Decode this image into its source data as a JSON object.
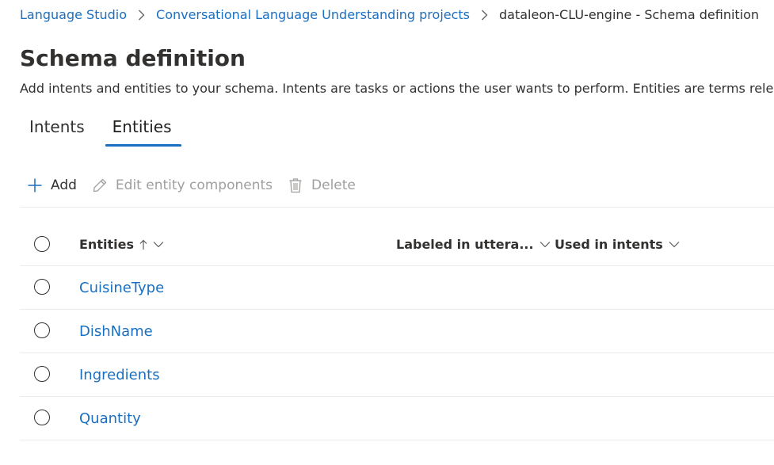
{
  "breadcrumb": {
    "items": [
      "Language Studio",
      "Conversational Language Understanding projects"
    ],
    "current": "dataleon-CLU-engine - Schema definition"
  },
  "page": {
    "title": "Schema definition",
    "description": "Add intents and entities to your schema. Intents are tasks or actions the user wants to perform. Entities are terms relevant to"
  },
  "tabs": [
    {
      "label": "Intents",
      "active": false
    },
    {
      "label": "Entities",
      "active": true
    }
  ],
  "toolbar": {
    "add_label": "Add",
    "edit_label": "Edit entity components",
    "delete_label": "Delete"
  },
  "table": {
    "columns": {
      "name": "Entities",
      "labeled": "Labeled in uttera...",
      "intents": "Used in intents"
    },
    "rows": [
      {
        "name": "CuisineType"
      },
      {
        "name": "DishName"
      },
      {
        "name": "Ingredients"
      },
      {
        "name": "Quantity"
      }
    ]
  },
  "icons": {
    "breadcrumb_separator": "chevron-right-icon",
    "add": "plus-icon",
    "edit": "pencil-icon",
    "delete": "trash-icon",
    "sort": "arrow-up-icon",
    "column_menu": "chevron-down-icon",
    "select": "radio-circle-icon"
  },
  "colors": {
    "link": "#1a6fc1",
    "text": "#323130",
    "disabled": "#a19f9d",
    "divider": "#edebe9"
  }
}
